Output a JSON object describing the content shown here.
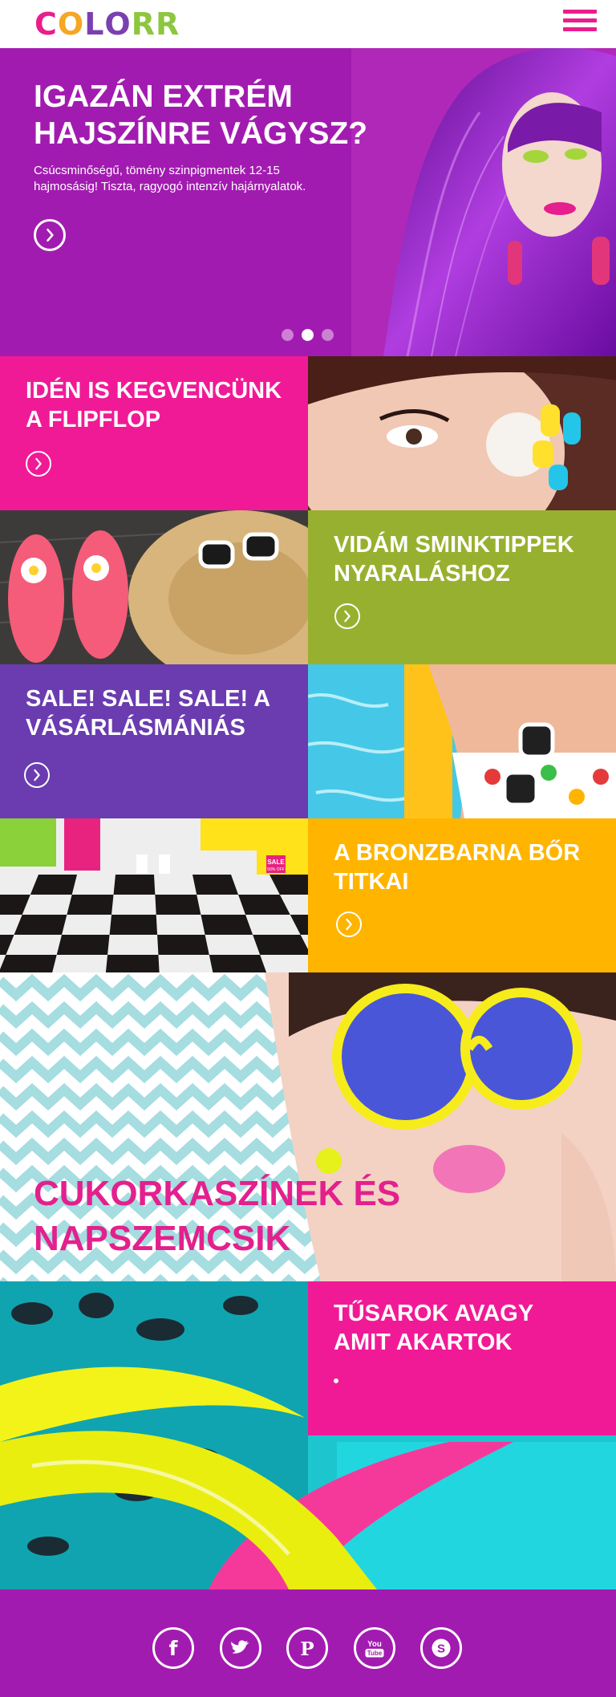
{
  "header": {
    "logo_letters": [
      "C",
      "O",
      "L",
      "O",
      "R",
      "R"
    ],
    "logo_colors": [
      "#e91e8c",
      "#f5a623",
      "#7b3fb0",
      "#7b3fb0",
      "#8dc63f",
      "#8dc63f"
    ]
  },
  "hero": {
    "title": "IGAZÁN EXTRÉM HAJSZÍNRE VÁGYSZ?",
    "text": "Csúcsminőségű, tömény szinpigmentek 12-15 hajmosásig! Tiszta, ragyogó intenzív hajárnyalatok.",
    "carousel_slides": 3,
    "active_slide": 2,
    "background": "#a21bb0"
  },
  "tiles": [
    {
      "title": "IDÉN IS KEGVENCÜNK A FLIPFLOP",
      "color": "#f11a96"
    },
    {
      "title": "VIDÁM SMINKTIPPEK NYARALÁSHOZ",
      "color": "#98b02f"
    },
    {
      "title": "SALE! SALE! SALE! A VÁSÁRLÁSMÁNIÁS",
      "color": "#6a3cb0"
    },
    {
      "title": "A BRONZBARNA BŐR TITKAI",
      "color": "#ffb400"
    }
  ],
  "sale_sign": {
    "line1": "SALE",
    "line2": "50% OFF"
  },
  "candy": {
    "title": "CUKORKASZÍNEK ÉS NAPSZEMCSIK",
    "title_color": "#e3208d"
  },
  "heel": {
    "title": "TŰSAROK AVAGY AMIT AKARTOK",
    "color": "#f11a96"
  },
  "footer": {
    "social": [
      {
        "name": "facebook-icon",
        "glyph": "f"
      },
      {
        "name": "twitter-icon",
        "glyph": "t"
      },
      {
        "name": "pinterest-icon",
        "glyph": "P"
      },
      {
        "name": "youtube-icon",
        "text_top": "You",
        "text_bottom": "Tube"
      },
      {
        "name": "skype-icon",
        "glyph": "S"
      }
    ],
    "background": "#a21bb0"
  }
}
